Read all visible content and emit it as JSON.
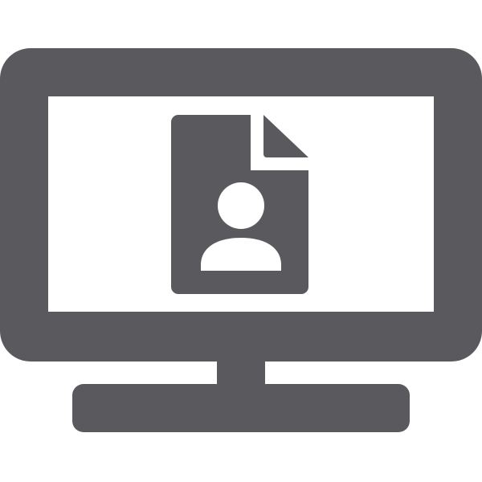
{
  "icon": {
    "name": "monitor-user-document-icon",
    "color": "#5a5a5e",
    "background": "#ffffff"
  }
}
